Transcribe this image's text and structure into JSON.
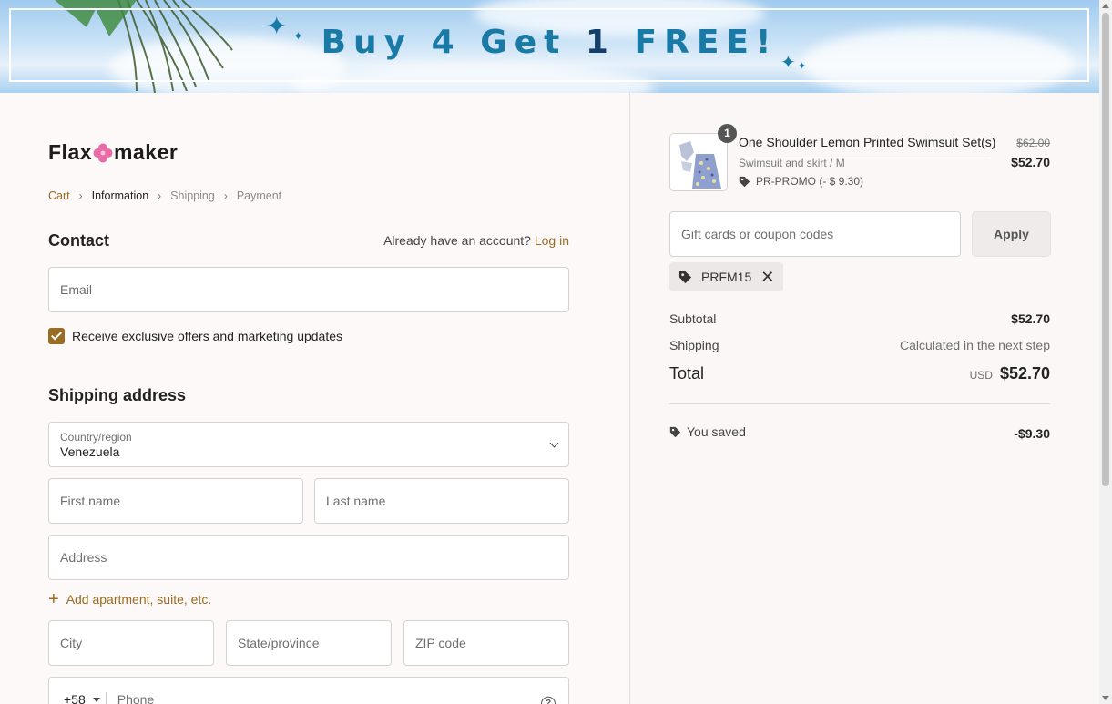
{
  "banner": {
    "promo_prefix": "Buy 4 Get ",
    "promo_num": "1",
    "promo_suffix": " FREE!"
  },
  "brand": {
    "name_left": "Flax",
    "name_right": "maker",
    "accent_color": "#9a6b22",
    "flower_color": "#e86aa6"
  },
  "breadcrumb": {
    "cart": "Cart",
    "information": "Information",
    "shipping": "Shipping",
    "payment": "Payment"
  },
  "contact": {
    "title": "Contact",
    "account_prompt": "Already have an account?",
    "login_link": "Log in",
    "email_placeholder": "Email",
    "marketing_label": "Receive exclusive offers and marketing updates",
    "marketing_checked": true
  },
  "shipping_address": {
    "title": "Shipping address",
    "country_label": "Country/region",
    "country_value": "Venezuela",
    "first_name_placeholder": "First name",
    "last_name_placeholder": "Last name",
    "address_placeholder": "Address",
    "add_apartment": "Add apartment, suite, etc.",
    "city_placeholder": "City",
    "state_placeholder": "State/province",
    "zip_placeholder": "ZIP code",
    "phone_code": "+58",
    "phone_placeholder": "Phone",
    "help_icon": "?"
  },
  "order": {
    "item": {
      "quantity": "1",
      "name": "One Shoulder Lemon Printed Swimsuit Set(s)",
      "variant": "Swimsuit and skirt / M",
      "discount": "PR-PROMO (- $ 9.30)",
      "original_price": "$62.00",
      "price": "$52.70"
    },
    "coupon_placeholder": "Gift cards or coupon codes",
    "apply_label": "Apply",
    "applied_code": "PRFM15",
    "subtotal_label": "Subtotal",
    "subtotal_value": "$52.70",
    "shipping_label": "Shipping",
    "shipping_value": "Calculated in the next step",
    "total_label": "Total",
    "currency": "USD",
    "total_value": "$52.70",
    "saved_label": "You saved",
    "saved_value": "-$9.30"
  }
}
